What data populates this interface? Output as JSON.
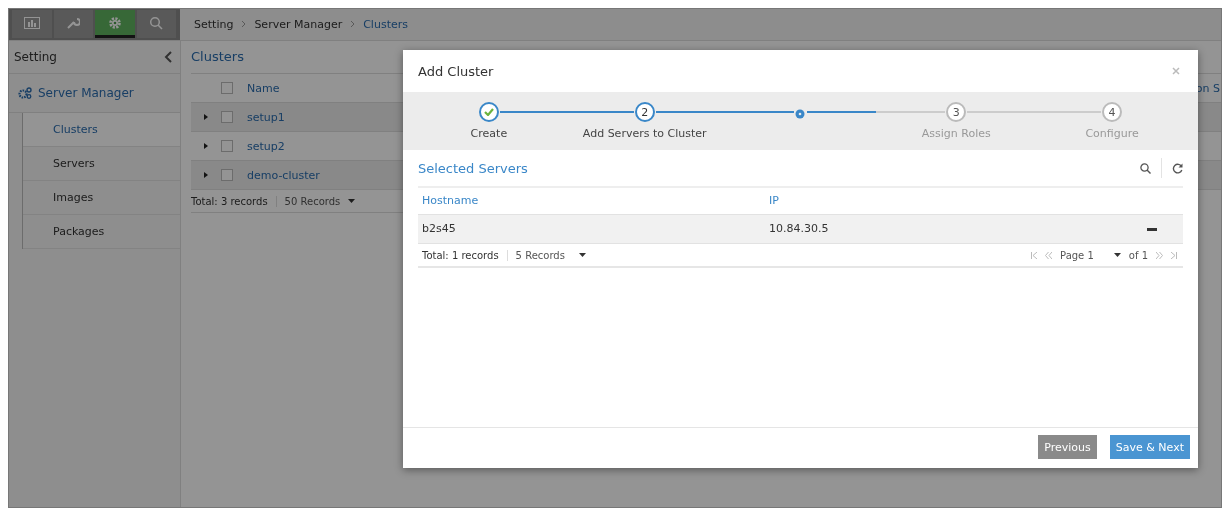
{
  "toolbar": {
    "tabs": [
      {
        "kind": "chart",
        "selected": false
      },
      {
        "kind": "wrench",
        "selected": false
      },
      {
        "kind": "gear",
        "selected": true
      },
      {
        "kind": "search",
        "selected": false
      }
    ]
  },
  "breadcrumb": [
    "Setting",
    "Server Manager",
    "Clusters"
  ],
  "sidebar": {
    "title": "Setting",
    "section": "Server Manager",
    "items": [
      {
        "label": "Clusters",
        "selected": true
      },
      {
        "label": "Servers",
        "selected": false
      },
      {
        "label": "Images",
        "selected": false
      },
      {
        "label": "Packages",
        "selected": false
      }
    ]
  },
  "clusters": {
    "title": "Clusters",
    "select_all_checked": false,
    "columns": [
      "Name",
      "on S"
    ],
    "rows": [
      {
        "name": "setup1",
        "checked": false
      },
      {
        "name": "setup2",
        "checked": false
      },
      {
        "name": "demo-cluster",
        "checked": false
      }
    ],
    "total": "Total: 3 records",
    "page_size": "50 Records"
  },
  "dialog": {
    "title": "Add Cluster",
    "stepper": {
      "steps": [
        {
          "label": "Create",
          "kind": "done"
        },
        {
          "number": "2",
          "label": "Add Servers to Cluster",
          "kind": "current"
        },
        {
          "number": "3",
          "label": "Assign Roles",
          "kind": "pending"
        },
        {
          "number": "4",
          "label": "Configure",
          "kind": "pending"
        }
      ]
    },
    "section": "Selected Servers",
    "columns": [
      "Hostname",
      "IP"
    ],
    "rows": [
      {
        "hostname": "b2s45",
        "ip": "10.84.30.5"
      }
    ],
    "total": "Total: 1 records",
    "page_size": "5 Records",
    "page": "Page 1",
    "of": "of 1",
    "buttons": [
      {
        "label": "Previous",
        "kind": "secondary"
      },
      {
        "label": "Save & Next",
        "kind": "primary"
      }
    ]
  }
}
